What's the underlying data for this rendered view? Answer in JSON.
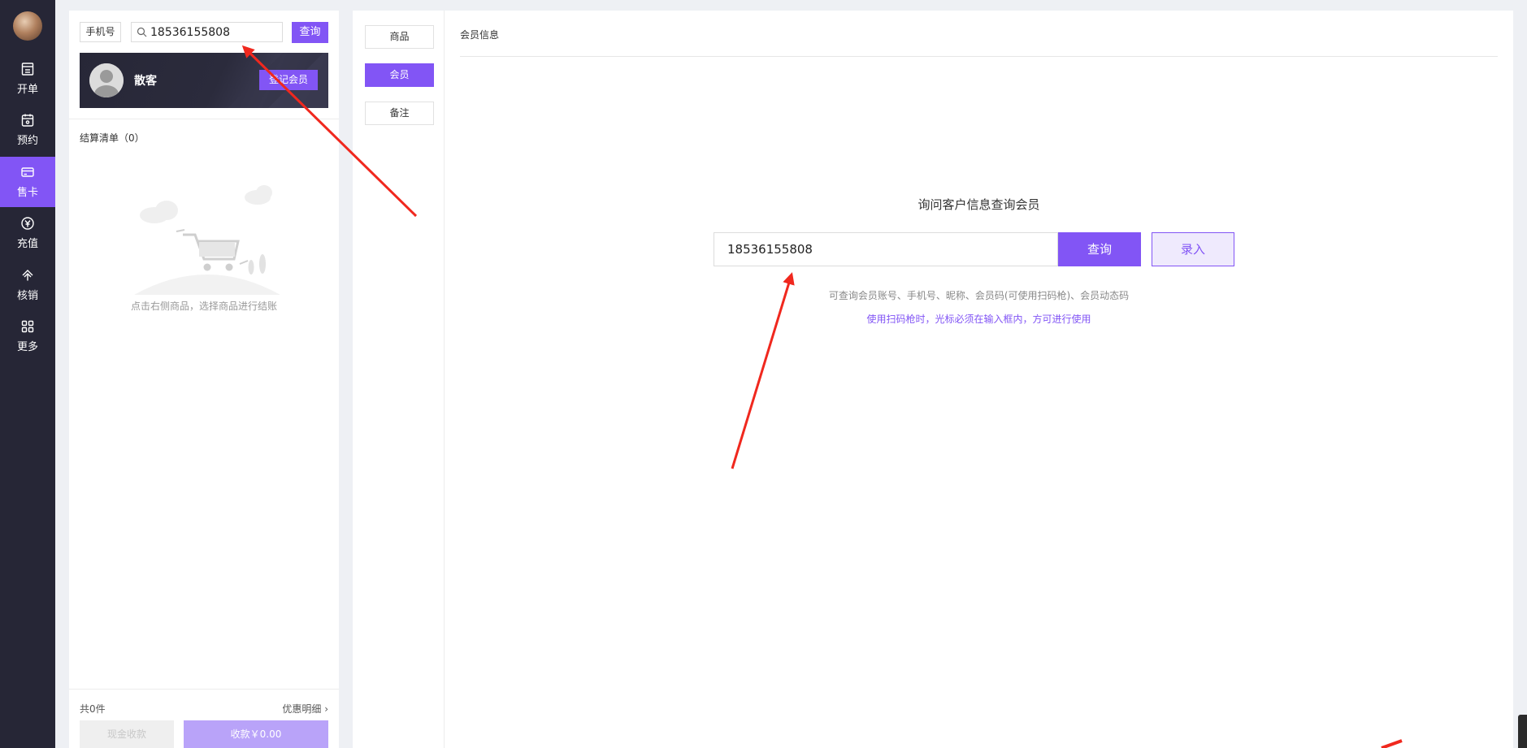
{
  "nav": {
    "items": [
      {
        "label": "开单",
        "icon": "order-icon"
      },
      {
        "label": "预约",
        "icon": "calendar-icon"
      },
      {
        "label": "售卡",
        "icon": "card-icon"
      },
      {
        "label": "充值",
        "icon": "yuan-coin-icon"
      },
      {
        "label": "核销",
        "icon": "verify-icon"
      },
      {
        "label": "更多",
        "icon": "grid-icon"
      }
    ],
    "active": "售卡"
  },
  "cart": {
    "search_type": "手机号",
    "search_value": "18536155808",
    "query_label": "查询",
    "member_name": "散客",
    "register_label": "登记会员",
    "list_title": "结算清单（0）",
    "empty_text": "点击右侧商品，选择商品进行结账",
    "total_count": "共0件",
    "discount_link": "优惠明细 ›",
    "cash_label": "现金收款",
    "pay_label": "收款￥0.00"
  },
  "tabs": [
    {
      "label": "商品"
    },
    {
      "label": "会员"
    },
    {
      "label": "备注"
    }
  ],
  "main": {
    "title": "会员信息",
    "heading": "询问客户信息查询会员",
    "input_value": "18536155808",
    "query_label": "查询",
    "enter_label": "录入",
    "hint_primary": "可查询会员账号、手机号、昵称、会员码(可使用扫码枪)、会员动态码",
    "hint_secondary": "使用扫码枪时，光标必须在输入框内，方可进行使用"
  },
  "colors": {
    "accent": "#8255f5",
    "nav_bg": "#262636",
    "annotation_arrow": "#f0281e"
  }
}
